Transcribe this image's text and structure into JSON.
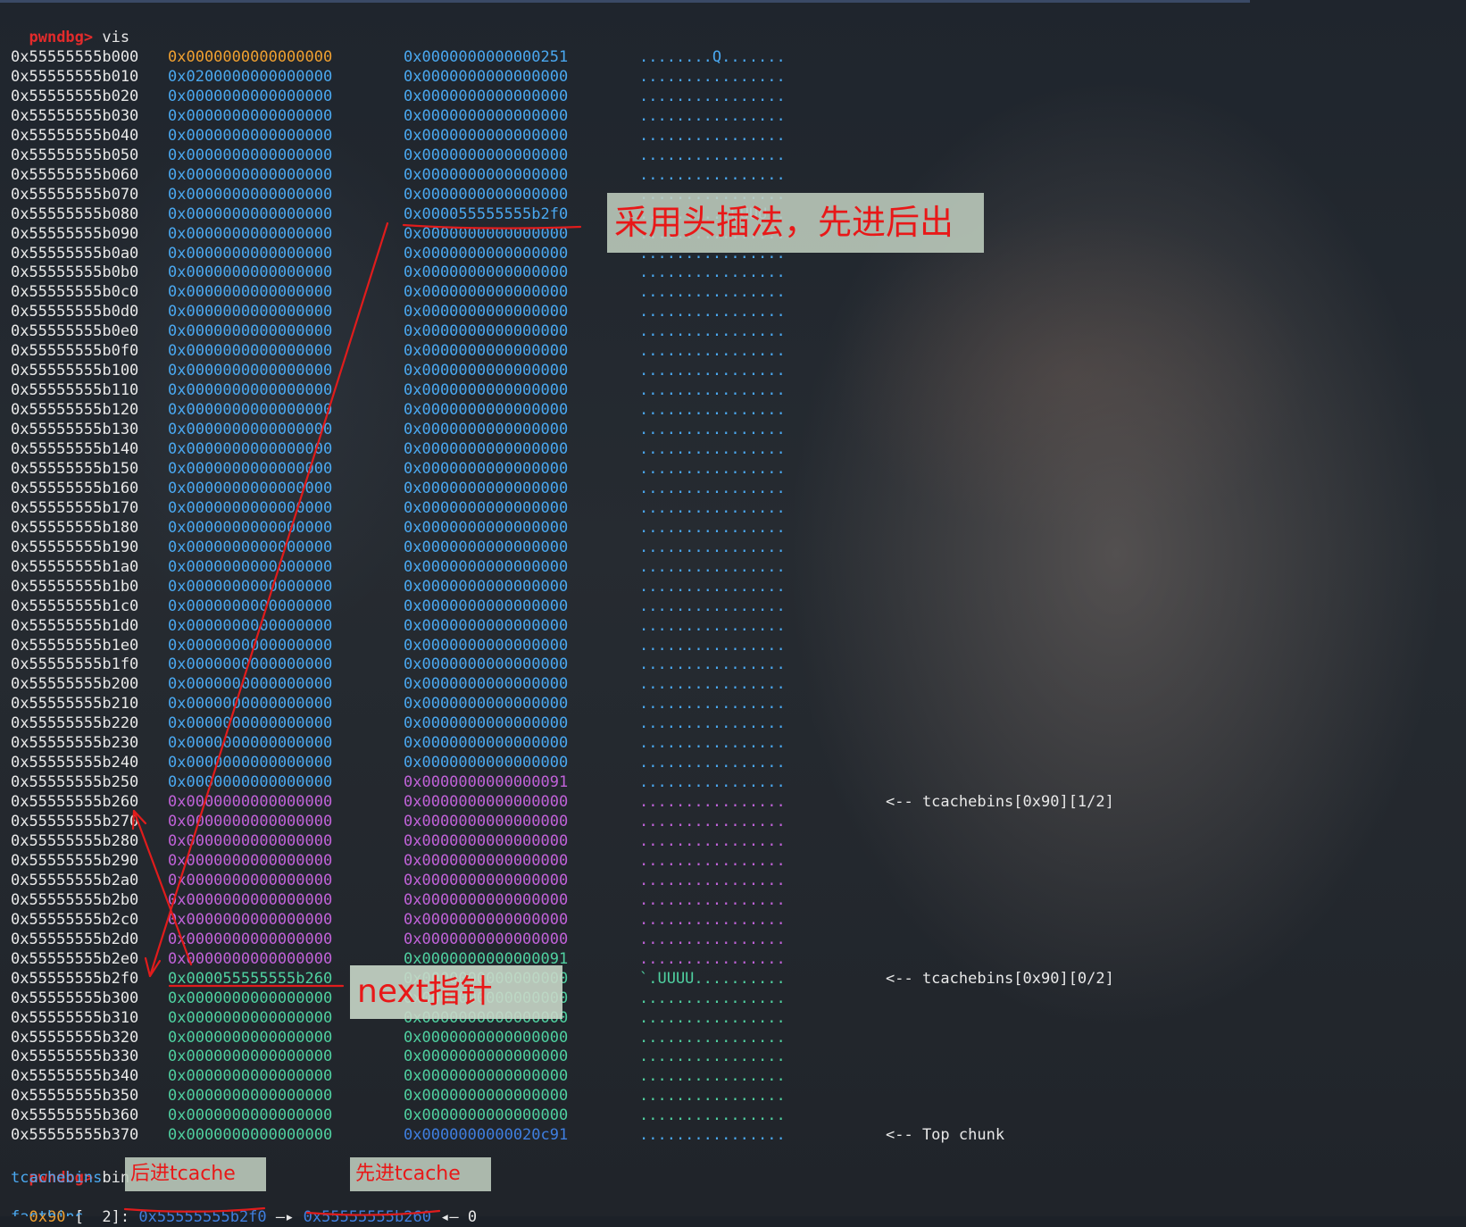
{
  "terminal": {
    "prompt": "pwndbg>",
    "cmd_vis": "vis",
    "cmd_bin": "bin",
    "rows": [
      {
        "addr": "0x55555555b000",
        "v1": "0x0000000000000000",
        "v2": "0x0000000000000251",
        "ascii": "........Q.......",
        "c1": "c-orange",
        "c2": "c-blue",
        "ca": "c-blue",
        "note": ""
      },
      {
        "addr": "0x55555555b010",
        "v1": "0x0200000000000000",
        "v2": "0x0000000000000000",
        "ascii": "................",
        "c1": "c-blue",
        "c2": "c-blue",
        "ca": "c-blue",
        "note": ""
      },
      {
        "addr": "0x55555555b020",
        "v1": "0x0000000000000000",
        "v2": "0x0000000000000000",
        "ascii": "................",
        "c1": "c-blue",
        "c2": "c-blue",
        "ca": "c-blue",
        "note": ""
      },
      {
        "addr": "0x55555555b030",
        "v1": "0x0000000000000000",
        "v2": "0x0000000000000000",
        "ascii": "................",
        "c1": "c-blue",
        "c2": "c-blue",
        "ca": "c-blue",
        "note": ""
      },
      {
        "addr": "0x55555555b040",
        "v1": "0x0000000000000000",
        "v2": "0x0000000000000000",
        "ascii": "................",
        "c1": "c-blue",
        "c2": "c-blue",
        "ca": "c-blue",
        "note": ""
      },
      {
        "addr": "0x55555555b050",
        "v1": "0x0000000000000000",
        "v2": "0x0000000000000000",
        "ascii": "................",
        "c1": "c-blue",
        "c2": "c-blue",
        "ca": "c-blue",
        "note": ""
      },
      {
        "addr": "0x55555555b060",
        "v1": "0x0000000000000000",
        "v2": "0x0000000000000000",
        "ascii": "................",
        "c1": "c-blue",
        "c2": "c-blue",
        "ca": "c-blue",
        "note": ""
      },
      {
        "addr": "0x55555555b070",
        "v1": "0x0000000000000000",
        "v2": "0x0000000000000000",
        "ascii": "................",
        "c1": "c-blue",
        "c2": "c-blue",
        "ca": "c-blue",
        "note": ""
      },
      {
        "addr": "0x55555555b080",
        "v1": "0x0000000000000000",
        "v2": "0x000055555555b2f0",
        "ascii": "..........UUUU..",
        "c1": "c-blue",
        "c2": "c-blue",
        "ca": "c-blue",
        "note": ""
      },
      {
        "addr": "0x55555555b090",
        "v1": "0x0000000000000000",
        "v2": "0x0000000000000000",
        "ascii": "................",
        "c1": "c-blue",
        "c2": "c-blue",
        "ca": "c-blue",
        "note": ""
      },
      {
        "addr": "0x55555555b0a0",
        "v1": "0x0000000000000000",
        "v2": "0x0000000000000000",
        "ascii": "................",
        "c1": "c-blue",
        "c2": "c-blue",
        "ca": "c-blue",
        "note": ""
      },
      {
        "addr": "0x55555555b0b0",
        "v1": "0x0000000000000000",
        "v2": "0x0000000000000000",
        "ascii": "................",
        "c1": "c-blue",
        "c2": "c-blue",
        "ca": "c-blue",
        "note": ""
      },
      {
        "addr": "0x55555555b0c0",
        "v1": "0x0000000000000000",
        "v2": "0x0000000000000000",
        "ascii": "................",
        "c1": "c-blue",
        "c2": "c-blue",
        "ca": "c-blue",
        "note": ""
      },
      {
        "addr": "0x55555555b0d0",
        "v1": "0x0000000000000000",
        "v2": "0x0000000000000000",
        "ascii": "................",
        "c1": "c-blue",
        "c2": "c-blue",
        "ca": "c-blue",
        "note": ""
      },
      {
        "addr": "0x55555555b0e0",
        "v1": "0x0000000000000000",
        "v2": "0x0000000000000000",
        "ascii": "................",
        "c1": "c-blue",
        "c2": "c-blue",
        "ca": "c-blue",
        "note": ""
      },
      {
        "addr": "0x55555555b0f0",
        "v1": "0x0000000000000000",
        "v2": "0x0000000000000000",
        "ascii": "................",
        "c1": "c-blue",
        "c2": "c-blue",
        "ca": "c-blue",
        "note": ""
      },
      {
        "addr": "0x55555555b100",
        "v1": "0x0000000000000000",
        "v2": "0x0000000000000000",
        "ascii": "................",
        "c1": "c-blue",
        "c2": "c-blue",
        "ca": "c-blue",
        "note": ""
      },
      {
        "addr": "0x55555555b110",
        "v1": "0x0000000000000000",
        "v2": "0x0000000000000000",
        "ascii": "................",
        "c1": "c-blue",
        "c2": "c-blue",
        "ca": "c-blue",
        "note": ""
      },
      {
        "addr": "0x55555555b120",
        "v1": "0x0000000000000000",
        "v2": "0x0000000000000000",
        "ascii": "................",
        "c1": "c-blue",
        "c2": "c-blue",
        "ca": "c-blue",
        "note": ""
      },
      {
        "addr": "0x55555555b130",
        "v1": "0x0000000000000000",
        "v2": "0x0000000000000000",
        "ascii": "................",
        "c1": "c-blue",
        "c2": "c-blue",
        "ca": "c-blue",
        "note": ""
      },
      {
        "addr": "0x55555555b140",
        "v1": "0x0000000000000000",
        "v2": "0x0000000000000000",
        "ascii": "................",
        "c1": "c-blue",
        "c2": "c-blue",
        "ca": "c-blue",
        "note": ""
      },
      {
        "addr": "0x55555555b150",
        "v1": "0x0000000000000000",
        "v2": "0x0000000000000000",
        "ascii": "................",
        "c1": "c-blue",
        "c2": "c-blue",
        "ca": "c-blue",
        "note": ""
      },
      {
        "addr": "0x55555555b160",
        "v1": "0x0000000000000000",
        "v2": "0x0000000000000000",
        "ascii": "................",
        "c1": "c-blue",
        "c2": "c-blue",
        "ca": "c-blue",
        "note": ""
      },
      {
        "addr": "0x55555555b170",
        "v1": "0x0000000000000000",
        "v2": "0x0000000000000000",
        "ascii": "................",
        "c1": "c-blue",
        "c2": "c-blue",
        "ca": "c-blue",
        "note": ""
      },
      {
        "addr": "0x55555555b180",
        "v1": "0x0000000000000000",
        "v2": "0x0000000000000000",
        "ascii": "................",
        "c1": "c-blue",
        "c2": "c-blue",
        "ca": "c-blue",
        "note": ""
      },
      {
        "addr": "0x55555555b190",
        "v1": "0x0000000000000000",
        "v2": "0x0000000000000000",
        "ascii": "................",
        "c1": "c-blue",
        "c2": "c-blue",
        "ca": "c-blue",
        "note": ""
      },
      {
        "addr": "0x55555555b1a0",
        "v1": "0x0000000000000000",
        "v2": "0x0000000000000000",
        "ascii": "................",
        "c1": "c-blue",
        "c2": "c-blue",
        "ca": "c-blue",
        "note": ""
      },
      {
        "addr": "0x55555555b1b0",
        "v1": "0x0000000000000000",
        "v2": "0x0000000000000000",
        "ascii": "................",
        "c1": "c-blue",
        "c2": "c-blue",
        "ca": "c-blue",
        "note": ""
      },
      {
        "addr": "0x55555555b1c0",
        "v1": "0x0000000000000000",
        "v2": "0x0000000000000000",
        "ascii": "................",
        "c1": "c-blue",
        "c2": "c-blue",
        "ca": "c-blue",
        "note": ""
      },
      {
        "addr": "0x55555555b1d0",
        "v1": "0x0000000000000000",
        "v2": "0x0000000000000000",
        "ascii": "................",
        "c1": "c-blue",
        "c2": "c-blue",
        "ca": "c-blue",
        "note": ""
      },
      {
        "addr": "0x55555555b1e0",
        "v1": "0x0000000000000000",
        "v2": "0x0000000000000000",
        "ascii": "................",
        "c1": "c-blue",
        "c2": "c-blue",
        "ca": "c-blue",
        "note": ""
      },
      {
        "addr": "0x55555555b1f0",
        "v1": "0x0000000000000000",
        "v2": "0x0000000000000000",
        "ascii": "................",
        "c1": "c-blue",
        "c2": "c-blue",
        "ca": "c-blue",
        "note": ""
      },
      {
        "addr": "0x55555555b200",
        "v1": "0x0000000000000000",
        "v2": "0x0000000000000000",
        "ascii": "................",
        "c1": "c-blue",
        "c2": "c-blue",
        "ca": "c-blue",
        "note": ""
      },
      {
        "addr": "0x55555555b210",
        "v1": "0x0000000000000000",
        "v2": "0x0000000000000000",
        "ascii": "................",
        "c1": "c-blue",
        "c2": "c-blue",
        "ca": "c-blue",
        "note": ""
      },
      {
        "addr": "0x55555555b220",
        "v1": "0x0000000000000000",
        "v2": "0x0000000000000000",
        "ascii": "................",
        "c1": "c-blue",
        "c2": "c-blue",
        "ca": "c-blue",
        "note": ""
      },
      {
        "addr": "0x55555555b230",
        "v1": "0x0000000000000000",
        "v2": "0x0000000000000000",
        "ascii": "................",
        "c1": "c-blue",
        "c2": "c-blue",
        "ca": "c-blue",
        "note": ""
      },
      {
        "addr": "0x55555555b240",
        "v1": "0x0000000000000000",
        "v2": "0x0000000000000000",
        "ascii": "................",
        "c1": "c-blue",
        "c2": "c-blue",
        "ca": "c-blue",
        "note": ""
      },
      {
        "addr": "0x55555555b250",
        "v1": "0x0000000000000000",
        "v2": "0x0000000000000091",
        "ascii": "................",
        "c1": "c-blue",
        "c2": "c-purple",
        "ca": "c-blue",
        "note": ""
      },
      {
        "addr": "0x55555555b260",
        "v1": "0x0000000000000000",
        "v2": "0x0000000000000000",
        "ascii": "................",
        "c1": "c-purple",
        "c2": "c-purple",
        "ca": "c-purple",
        "note": "<-- tcachebins[0x90][1/2]"
      },
      {
        "addr": "0x55555555b270",
        "v1": "0x0000000000000000",
        "v2": "0x0000000000000000",
        "ascii": "................",
        "c1": "c-purple",
        "c2": "c-purple",
        "ca": "c-purple",
        "note": ""
      },
      {
        "addr": "0x55555555b280",
        "v1": "0x0000000000000000",
        "v2": "0x0000000000000000",
        "ascii": "................",
        "c1": "c-purple",
        "c2": "c-purple",
        "ca": "c-purple",
        "note": ""
      },
      {
        "addr": "0x55555555b290",
        "v1": "0x0000000000000000",
        "v2": "0x0000000000000000",
        "ascii": "................",
        "c1": "c-purple",
        "c2": "c-purple",
        "ca": "c-purple",
        "note": ""
      },
      {
        "addr": "0x55555555b2a0",
        "v1": "0x0000000000000000",
        "v2": "0x0000000000000000",
        "ascii": "................",
        "c1": "c-purple",
        "c2": "c-purple",
        "ca": "c-purple",
        "note": ""
      },
      {
        "addr": "0x55555555b2b0",
        "v1": "0x0000000000000000",
        "v2": "0x0000000000000000",
        "ascii": "................",
        "c1": "c-purple",
        "c2": "c-purple",
        "ca": "c-purple",
        "note": ""
      },
      {
        "addr": "0x55555555b2c0",
        "v1": "0x0000000000000000",
        "v2": "0x0000000000000000",
        "ascii": "................",
        "c1": "c-purple",
        "c2": "c-purple",
        "ca": "c-purple",
        "note": ""
      },
      {
        "addr": "0x55555555b2d0",
        "v1": "0x0000000000000000",
        "v2": "0x0000000000000000",
        "ascii": "................",
        "c1": "c-purple",
        "c2": "c-purple",
        "ca": "c-purple",
        "note": ""
      },
      {
        "addr": "0x55555555b2e0",
        "v1": "0x0000000000000000",
        "v2": "0x0000000000000091",
        "ascii": "................",
        "c1": "c-purple",
        "c2": "c-green",
        "ca": "c-purple",
        "note": ""
      },
      {
        "addr": "0x55555555b2f0",
        "v1": "0x000055555555b260",
        "v2": "0x0000000000000000",
        "ascii": "`.UUUU..........",
        "c1": "c-green",
        "c2": "c-green",
        "ca": "c-green",
        "note": "<-- tcachebins[0x90][0/2]"
      },
      {
        "addr": "0x55555555b300",
        "v1": "0x0000000000000000",
        "v2": "0x0000000000000000",
        "ascii": "................",
        "c1": "c-green",
        "c2": "c-green",
        "ca": "c-green",
        "note": ""
      },
      {
        "addr": "0x55555555b310",
        "v1": "0x0000000000000000",
        "v2": "0x0000000000000000",
        "ascii": "................",
        "c1": "c-green",
        "c2": "c-green",
        "ca": "c-green",
        "note": ""
      },
      {
        "addr": "0x55555555b320",
        "v1": "0x0000000000000000",
        "v2": "0x0000000000000000",
        "ascii": "................",
        "c1": "c-green",
        "c2": "c-green",
        "ca": "c-green",
        "note": ""
      },
      {
        "addr": "0x55555555b330",
        "v1": "0x0000000000000000",
        "v2": "0x0000000000000000",
        "ascii": "................",
        "c1": "c-green",
        "c2": "c-green",
        "ca": "c-green",
        "note": ""
      },
      {
        "addr": "0x55555555b340",
        "v1": "0x0000000000000000",
        "v2": "0x0000000000000000",
        "ascii": "................",
        "c1": "c-green",
        "c2": "c-green",
        "ca": "c-green",
        "note": ""
      },
      {
        "addr": "0x55555555b350",
        "v1": "0x0000000000000000",
        "v2": "0x0000000000000000",
        "ascii": "................",
        "c1": "c-green",
        "c2": "c-green",
        "ca": "c-green",
        "note": ""
      },
      {
        "addr": "0x55555555b360",
        "v1": "0x0000000000000000",
        "v2": "0x0000000000000000",
        "ascii": "................",
        "c1": "c-green",
        "c2": "c-green",
        "ca": "c-green",
        "note": ""
      },
      {
        "addr": "0x55555555b370",
        "v1": "0x0000000000000000",
        "v2": "0x0000000000020c91",
        "ascii": "................",
        "c1": "c-green",
        "c2": "c-dblue",
        "ca": "c-blue",
        "note": "<-- Top chunk"
      }
    ],
    "bins": {
      "tcache_label": "tcachebins",
      "size": "0x90",
      "count": "[  2]:",
      "first": "0x55555555b2f0",
      "arrow1": "—▸",
      "second": "0x55555555b260",
      "arrow2": "◂— 0",
      "fastbins_label": "fastbins"
    }
  },
  "annotations": {
    "head_insert": "采用头插法，先进后出",
    "next_ptr": "next指针",
    "later_in": "后进tcache",
    "first_in": "先进tcache"
  },
  "colors": {
    "orange": "#f0a030",
    "blue": "#4aa8f0",
    "purple": "#c062d8",
    "green": "#4fd0a0",
    "annotation_red": "#e81818"
  }
}
